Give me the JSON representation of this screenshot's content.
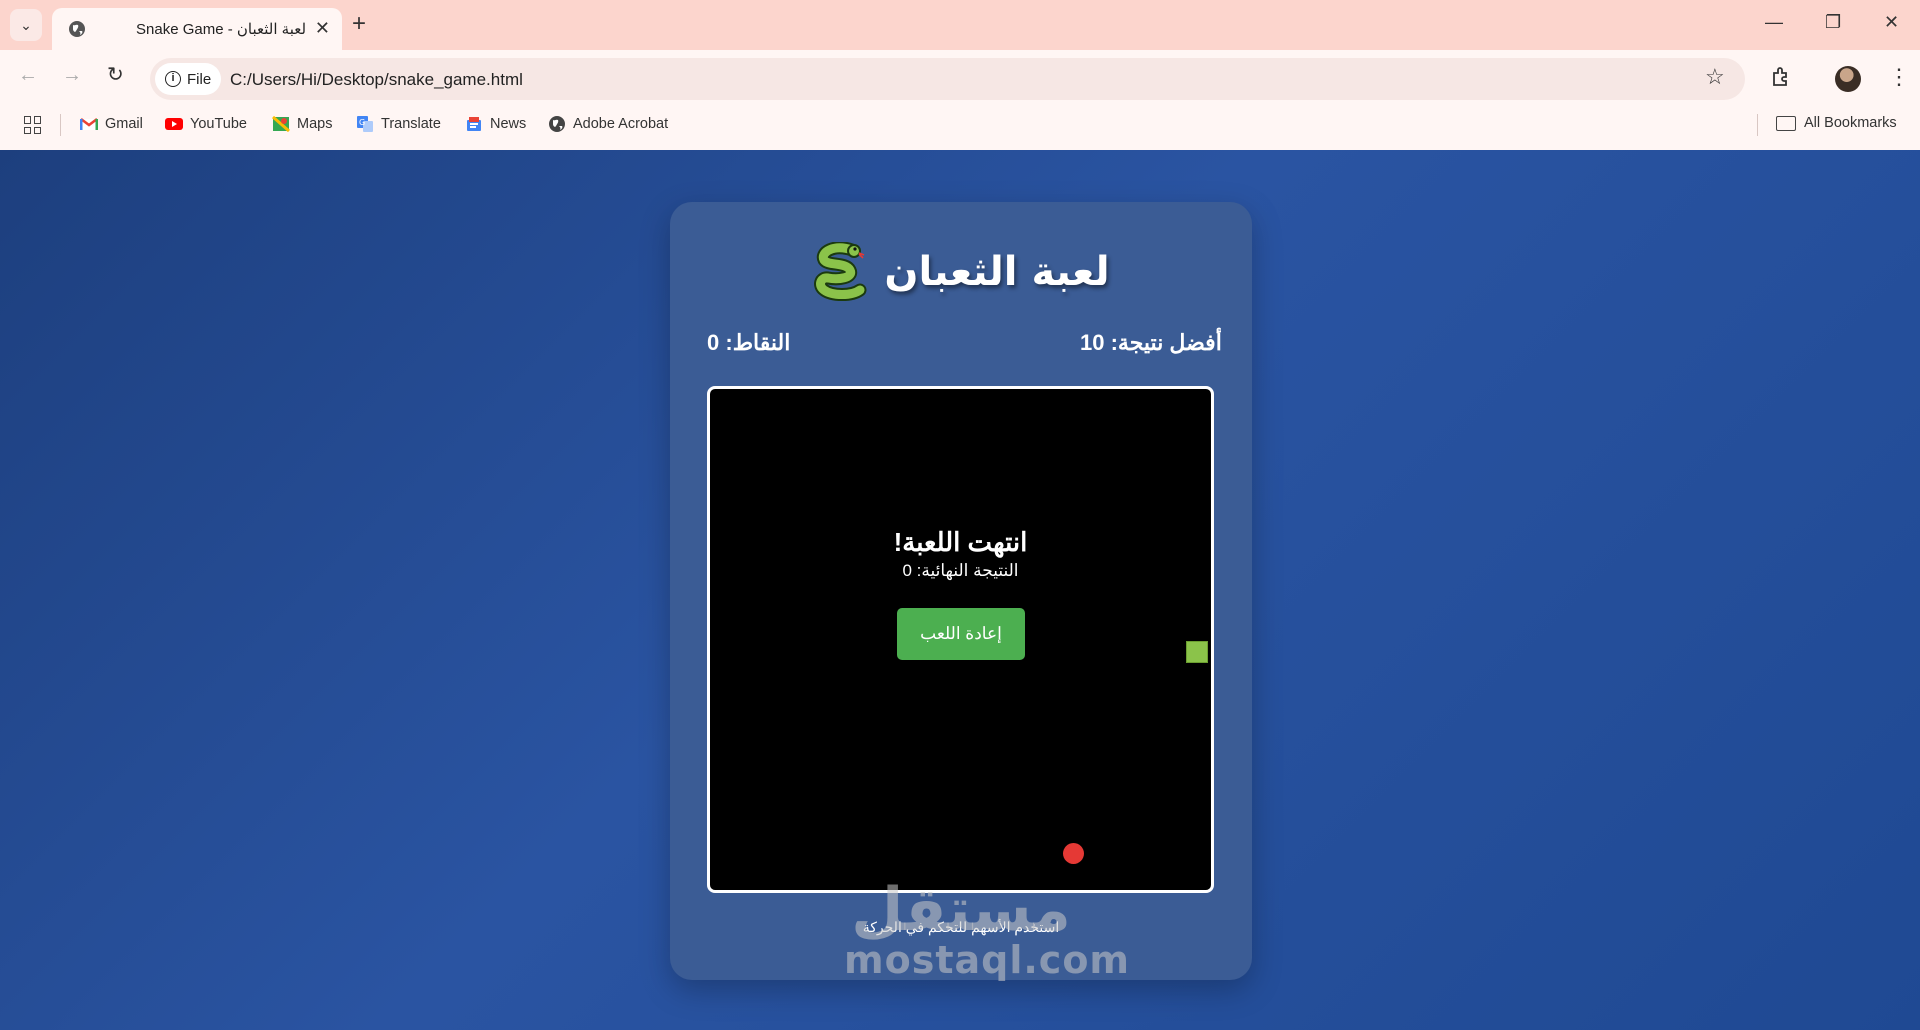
{
  "browser": {
    "tab_title": "Snake Game - لعبة الثعبان",
    "address_chip": "File",
    "url": "C:/Users/Hi/Desktop/snake_game.html",
    "bookmarks": [
      "Gmail",
      "YouTube",
      "Maps",
      "Translate",
      "News",
      "Adobe Acrobat"
    ],
    "all_bookmarks": "All Bookmarks"
  },
  "game": {
    "title": "لعبة الثعبان",
    "best_score_label": "أفضل نتيجة: 10",
    "score_label": "النقاط: 0",
    "game_over_title": "انتهت اللعبة!",
    "final_score_label": "النتيجة النهائية: 0",
    "restart_label": "إعادة اللعب",
    "hint": "استخدم الأسهم للتحكم في الحركة",
    "snake_color": "#8bc34a",
    "food_color": "#e53935"
  },
  "watermark": {
    "arabic": "مستقل",
    "latin": "mostaql.com"
  }
}
